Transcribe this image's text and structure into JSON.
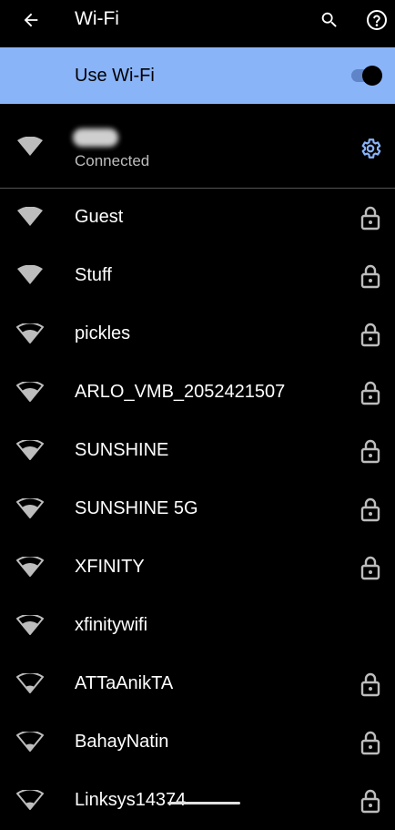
{
  "header": {
    "title": "Wi-Fi",
    "back_icon": "arrow-left-icon",
    "search_icon": "search-icon",
    "help_icon": "help-icon"
  },
  "master_toggle": {
    "label": "Use Wi-Fi",
    "state": "on",
    "accent": "#8ab4f8"
  },
  "connected_network": {
    "status": "Connected",
    "signal_icon": "wifi-full-icon",
    "settings_icon": "gear-icon"
  },
  "networks": [
    {
      "name": "Guest",
      "secured": true,
      "signal": "full"
    },
    {
      "name": "Stuff",
      "secured": true,
      "signal": "full"
    },
    {
      "name": "pickles",
      "secured": true,
      "signal": "medium"
    },
    {
      "name": "ARLO_VMB_2052421507",
      "secured": true,
      "signal": "medium"
    },
    {
      "name": "SUNSHINE",
      "secured": true,
      "signal": "medium"
    },
    {
      "name": "SUNSHINE 5G",
      "secured": true,
      "signal": "medium"
    },
    {
      "name": "XFINITY",
      "secured": true,
      "signal": "medium"
    },
    {
      "name": "xfinitywifi",
      "secured": false,
      "signal": "medium"
    },
    {
      "name": "ATTaAnikTA",
      "secured": true,
      "signal": "low"
    },
    {
      "name": "BahayNatin",
      "secured": true,
      "signal": "low"
    },
    {
      "name": "Linksys14374",
      "secured": true,
      "signal": "low"
    }
  ]
}
